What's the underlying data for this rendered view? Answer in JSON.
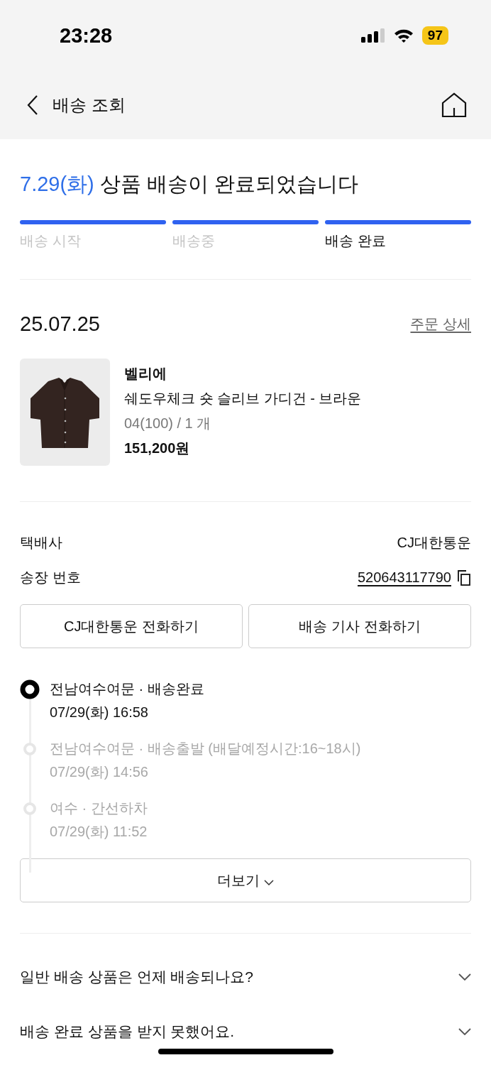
{
  "status_bar": {
    "time": "23:28",
    "battery": "97"
  },
  "header": {
    "title": "배송 조회"
  },
  "summary": {
    "date": "7.29(화)",
    "message": "상품 배송이 완료되었습니다"
  },
  "steps": [
    {
      "label": "배송 시작",
      "done": true,
      "selected": false
    },
    {
      "label": "배송중",
      "done": true,
      "selected": false
    },
    {
      "label": "배송 완료",
      "done": true,
      "selected": true
    }
  ],
  "order": {
    "date": "25.07.25",
    "detail_link": "주문 상세"
  },
  "product": {
    "brand": "벨리에",
    "name": "쉐도우체크 숏 슬리브 가디건 - 브라운",
    "option": "04(100) / 1 개",
    "price": "151,200원"
  },
  "shipping": {
    "carrier_label": "택배사",
    "carrier": "CJ대한통운",
    "tracking_label": "송장 번호",
    "tracking_number": "520643117790"
  },
  "buttons": [
    "CJ대한통운 전화하기",
    "배송 기사 전화하기"
  ],
  "timeline": [
    {
      "place": "전남여수여문 · 배송완료",
      "time": "07/29(화) 16:58",
      "selected": true
    },
    {
      "place": "전남여수여문 · 배송출발 (배달예정시간:16~18시)",
      "time": "07/29(화) 14:56",
      "selected": false
    },
    {
      "place": "여수 · 간선하차",
      "time": "07/29(화) 11:52",
      "selected": false
    }
  ],
  "more_button": "더보기",
  "faq": [
    {
      "question": "일반 배송 상품은 언제 배송되나요?",
      "expanded": false
    },
    {
      "question": "배송 완료 상품을 받지 못했어요.",
      "expanded": false
    }
  ]
}
